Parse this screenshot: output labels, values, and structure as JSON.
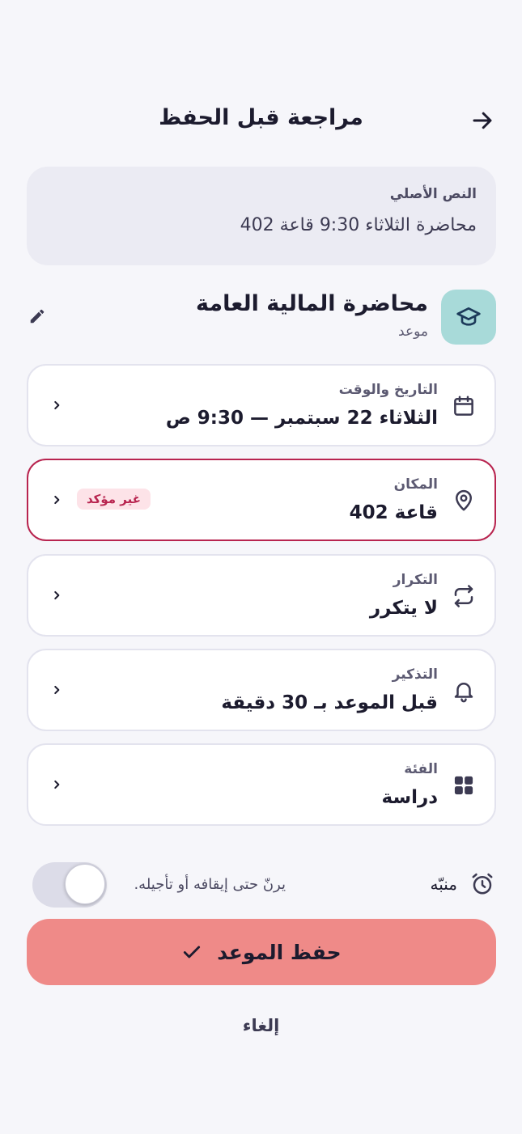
{
  "header": {
    "title": "مراجعة قبل الحفظ"
  },
  "original": {
    "label": "النص الأصلي",
    "text": "محاضرة الثلاثاء 9:30 قاعة 402"
  },
  "event": {
    "title": "محاضرة المالية العامة",
    "type": "موعد",
    "icon": "graduation-cap-icon",
    "accent": "#a8dad9"
  },
  "fields": [
    {
      "label": "التاريخ والوقت",
      "value": "الثلاثاء 22 سبتمبر — 9:30 ص",
      "icon": "calendar-icon"
    },
    {
      "label": "المكان",
      "value": "قاعة 402",
      "icon": "location-pin-icon",
      "badge": "غير مؤكد",
      "warning_color": "#b8244f"
    },
    {
      "label": "التكرار",
      "value": "لا يتكرر",
      "icon": "repeat-icon"
    },
    {
      "label": "التذكير",
      "value": "قبل الموعد بـ 30 دقيقة",
      "icon": "bell-icon"
    },
    {
      "label": "الفئة",
      "value": "دراسة",
      "icon": "grid-icon"
    }
  ],
  "alarm": {
    "label": "منبّه",
    "description": "يرنّ حتى إيقافه أو تأجيله.",
    "enabled": false
  },
  "actions": {
    "save": "حفظ الموعد",
    "cancel": "إلغاء",
    "save_color": "#ef8a88"
  }
}
